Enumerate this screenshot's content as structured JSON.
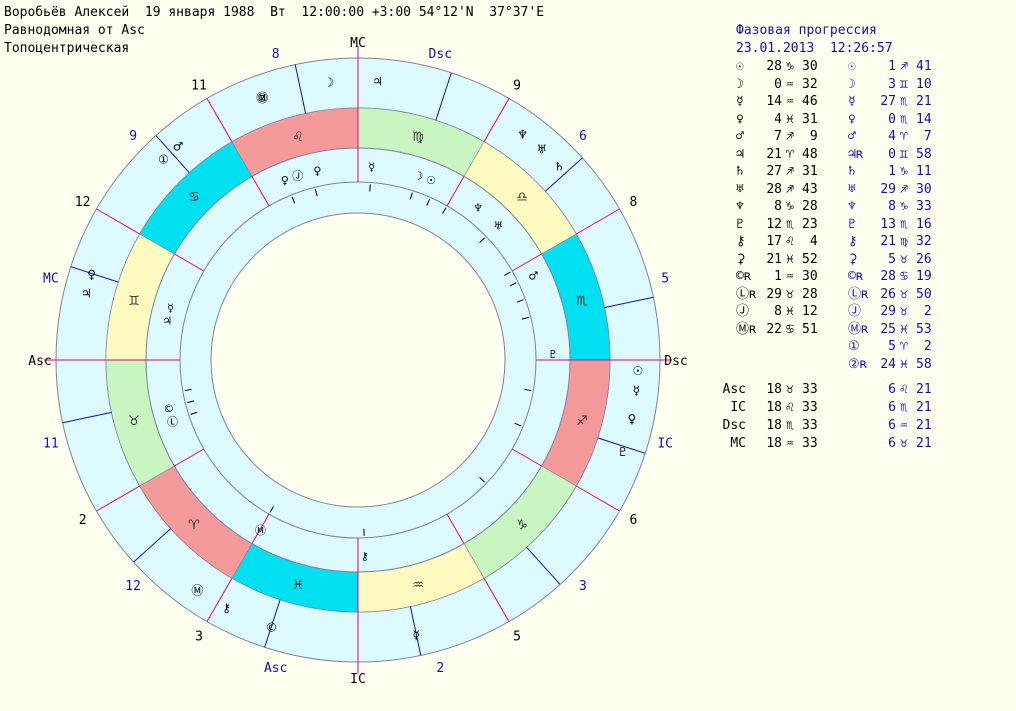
{
  "header": {
    "line1": "Воробьёв Алексей  19 января 1988  Вт  12:00:00 +3:00 54°12'N  37°37'E",
    "line2": "Равнодомная от Asc",
    "line3": "Топоцентрическая"
  },
  "colors": {
    "background": "#fffff0",
    "ring_fill": "#dcfaff",
    "zodiac_fire": "#f59a9a",
    "zodiac_earth": "#c8f5c0",
    "zodiac_air": "#fffac0",
    "zodiac_water": "#00e0f0",
    "blue_text": "#1010b0",
    "cusp_line": "#e0008a"
  },
  "wheel": {
    "outer_house_labels": [
      {
        "label": "MC",
        "color": "black"
      },
      {
        "label": "Dsc",
        "color": "blue"
      },
      {
        "label": "9",
        "color": "black"
      },
      {
        "label": "6",
        "color": "blue"
      },
      {
        "label": "8",
        "color": "black"
      },
      {
        "label": "5",
        "color": "blue"
      },
      {
        "label": "Dsc",
        "color": "black"
      },
      {
        "label": "IC",
        "color": "blue"
      },
      {
        "label": "6",
        "color": "black"
      },
      {
        "label": "3",
        "color": "blue"
      },
      {
        "label": "5",
        "color": "black"
      },
      {
        "label": "2",
        "color": "blue"
      },
      {
        "label": "IC",
        "color": "black"
      },
      {
        "label": "Asc",
        "color": "blue"
      },
      {
        "label": "3",
        "color": "black"
      },
      {
        "label": "12",
        "color": "blue"
      },
      {
        "label": "2",
        "color": "black"
      },
      {
        "label": "11",
        "color": "blue"
      },
      {
        "label": "Asc",
        "color": "black"
      },
      {
        "label": "MC",
        "color": "blue"
      },
      {
        "label": "12",
        "color": "black"
      },
      {
        "label": "9",
        "color": "blue"
      },
      {
        "label": "11",
        "color": "black"
      },
      {
        "label": "8",
        "color": "blue"
      }
    ],
    "zodiac_signs": [
      {
        "glyph": "♉",
        "element": "earth"
      },
      {
        "glyph": "♊",
        "element": "air"
      },
      {
        "glyph": "♋",
        "element": "water"
      },
      {
        "glyph": "♌",
        "element": "fire"
      },
      {
        "glyph": "♍",
        "element": "earth"
      },
      {
        "glyph": "♎",
        "element": "air"
      },
      {
        "glyph": "♏",
        "element": "water"
      },
      {
        "glyph": "♐",
        "element": "fire"
      },
      {
        "glyph": "♑",
        "element": "earth"
      },
      {
        "glyph": "♒",
        "element": "air"
      },
      {
        "glyph": "♓",
        "element": "water"
      },
      {
        "glyph": "♈",
        "element": "fire"
      }
    ],
    "outer_planets": [
      "♃",
      "☽",
      "♆",
      "♅",
      "♄",
      "☉",
      "☿",
      "♀",
      "♇",
      "☿",
      "⚷",
      "©",
      "Ⓜ",
      "②",
      "Ⓜ",
      "①",
      "♂",
      "♀",
      "♃"
    ],
    "inner_planets": [
      "☿",
      "☽",
      "☉",
      "♆",
      "♅",
      "♂",
      "♇",
      "⚷",
      "♀",
      "Ⓙ",
      "♀",
      "Ⓛ",
      "©",
      "Ⓜ",
      "♃",
      "☿"
    ]
  },
  "progression": {
    "title": "Фазовая прогрессия",
    "date": "23.01.2013",
    "time": "12:26:57",
    "rows": [
      {
        "sym1": "☉",
        "deg1": "28",
        "sign1": "♑",
        "min1": "30",
        "sym2": "☉",
        "deg2": "1",
        "sign2": "♐",
        "min2": "41"
      },
      {
        "sym1": "☽",
        "deg1": "0",
        "sign1": "♒",
        "min1": "32",
        "sym2": "☽",
        "deg2": "3",
        "sign2": "♊",
        "min2": "10"
      },
      {
        "sym1": "☿",
        "deg1": "14",
        "sign1": "♒",
        "min1": "46",
        "sym2": "☿",
        "deg2": "27",
        "sign2": "♏",
        "min2": "21"
      },
      {
        "sym1": "♀",
        "deg1": "4",
        "sign1": "♓",
        "min1": "31",
        "sym2": "♀",
        "deg2": "0",
        "sign2": "♏",
        "min2": "14"
      },
      {
        "sym1": "♂",
        "deg1": "7",
        "sign1": "♐",
        "min1": " 9",
        "sym2": "♂",
        "deg2": "4",
        "sign2": "♈",
        "min2": " 7"
      },
      {
        "sym1": "♃",
        "deg1": "21",
        "sign1": "♈",
        "min1": "48",
        "sym2": "♃ʀ",
        "deg2": "0",
        "sign2": "♊",
        "min2": "58"
      },
      {
        "sym1": "♄",
        "deg1": "27",
        "sign1": "♐",
        "min1": "31",
        "sym2": "♄",
        "deg2": "1",
        "sign2": "♑",
        "min2": "11"
      },
      {
        "sym1": "♅",
        "deg1": "28",
        "sign1": "♐",
        "min1": "43",
        "sym2": "♅",
        "deg2": "29",
        "sign2": "♐",
        "min2": "30"
      },
      {
        "sym1": "♆",
        "deg1": "8",
        "sign1": "♑",
        "min1": "28",
        "sym2": "♆",
        "deg2": "8",
        "sign2": "♑",
        "min2": "33"
      },
      {
        "sym1": "♇",
        "deg1": "12",
        "sign1": "♏",
        "min1": "23",
        "sym2": "♇",
        "deg2": "13",
        "sign2": "♏",
        "min2": "16"
      },
      {
        "sym1": "⚷",
        "deg1": "17",
        "sign1": "♌",
        "min1": " 4",
        "sym2": "⚷",
        "deg2": "21",
        "sign2": "♍",
        "min2": "32"
      },
      {
        "sym1": "⚳",
        "deg1": "21",
        "sign1": "♓",
        "min1": "52",
        "sym2": "⚳",
        "deg2": "5",
        "sign2": "♉",
        "min2": "26"
      },
      {
        "sym1": "©ʀ",
        "deg1": "1",
        "sign1": "♒",
        "min1": "30",
        "sym2": "©ʀ",
        "deg2": "28",
        "sign2": "♋",
        "min2": "19"
      },
      {
        "sym1": "Ⓛʀ",
        "deg1": "29",
        "sign1": "♉",
        "min1": "28",
        "sym2": "Ⓛʀ",
        "deg2": "26",
        "sign2": "♉",
        "min2": "50"
      },
      {
        "sym1": "Ⓙ",
        "deg1": "8",
        "sign1": "♓",
        "min1": "12",
        "sym2": "Ⓙ",
        "deg2": "29",
        "sign2": "♉",
        "min2": " 2"
      },
      {
        "sym1": "Ⓜʀ",
        "deg1": "22",
        "sign1": "♋",
        "min1": "51",
        "sym2": "Ⓜʀ",
        "deg2": "25",
        "sign2": "♓",
        "min2": "53"
      },
      {
        "sym1": "",
        "deg1": "",
        "sign1": "",
        "min1": "",
        "sym2": "①",
        "deg2": "5",
        "sign2": "♈",
        "min2": " 2"
      },
      {
        "sym1": "",
        "deg1": "",
        "sign1": "",
        "min1": "",
        "sym2": "②ʀ",
        "deg2": "24",
        "sign2": "♓",
        "min2": "58"
      }
    ],
    "angles": [
      {
        "name": "Asc",
        "deg1": "18",
        "sign1": "♉",
        "min1": "33",
        "deg2": "6",
        "sign2": "♌",
        "min2": "21"
      },
      {
        "name": "IC",
        "deg1": "18",
        "sign1": "♌",
        "min1": "33",
        "deg2": "6",
        "sign2": "♏",
        "min2": "21"
      },
      {
        "name": "Dsc",
        "deg1": "18",
        "sign1": "♏",
        "min1": "33",
        "deg2": "6",
        "sign2": "♒",
        "min2": "21"
      },
      {
        "name": "MC",
        "deg1": "18",
        "sign1": "♒",
        "min1": "33",
        "deg2": "6",
        "sign2": "♉",
        "min2": "21"
      }
    ]
  }
}
